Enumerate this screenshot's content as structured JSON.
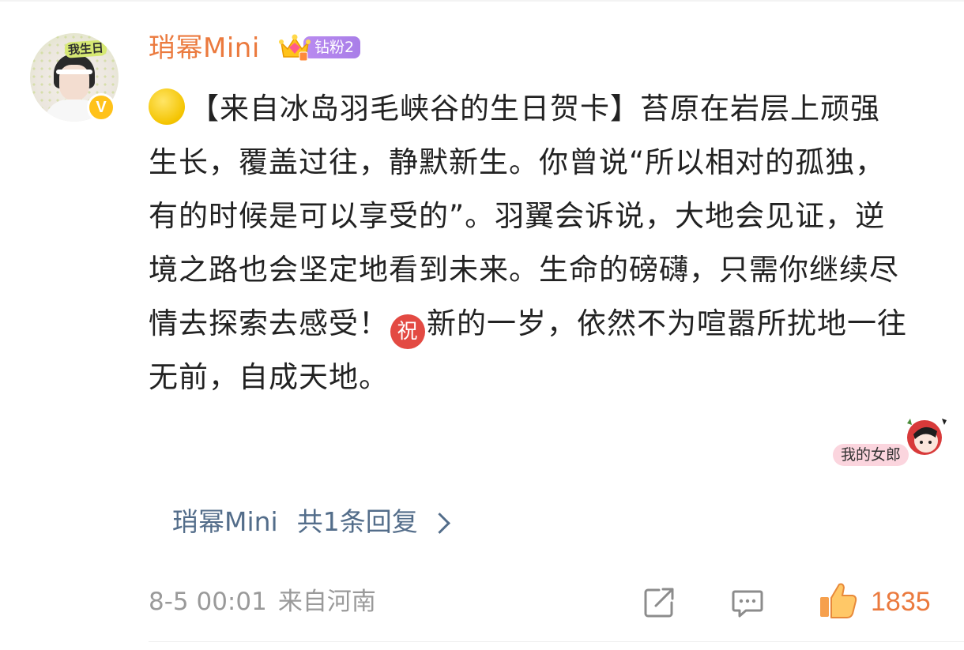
{
  "comment": {
    "username": "琑幂Mini",
    "fan_badge": {
      "icon": "crown-icon",
      "label": "钻粉2",
      "color": "#b38bef"
    },
    "verified_icon": "verified-v-icon",
    "avatar_text": "我生日",
    "body": {
      "leading_emoji": "yellow-circle-icon",
      "part1": "【来自冰岛羽毛峡谷的生日贺卡】苔原在岩层上顽强生长，覆盖过往，静默新生。你曾说“所以相对的孤独，有的时候是可以享受的”。羽翼会诉说，大地会见证，逆境之路也会坚定地看到未来。生命的磅礴，只需你继续尽情去探索去感受！",
      "inline_emoji_label": "祝",
      "part2": "新的一岁，依然不为喧嚣所扰地一往无前，自成天地。"
    },
    "sticker_text": "我的女郎",
    "reply_summary": {
      "replier": "琑幂Mini",
      "count_text": "共1条回复"
    },
    "timestamp": "8-5 00:01",
    "location": "来自河南",
    "actions": {
      "share_icon": "share-icon",
      "comment_icon": "comment-icon",
      "like_icon": "thumbs-up-icon",
      "like_count": "1835"
    },
    "colors": {
      "username": "#eb7a3e",
      "link": "#536d8a",
      "meta": "#9a9a9a",
      "like": "#eb7a3e"
    }
  }
}
